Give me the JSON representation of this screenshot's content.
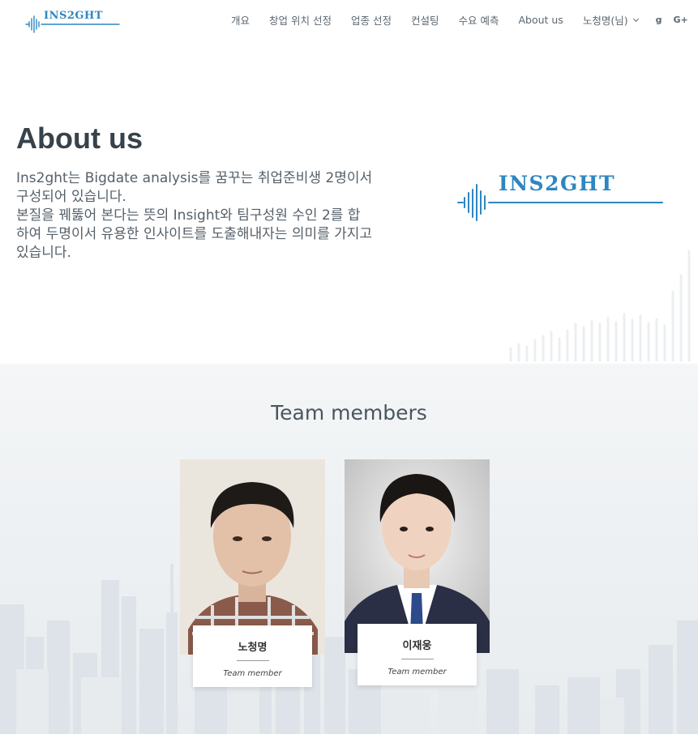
{
  "header": {
    "logo_text": "INS2GHT",
    "nav": [
      "개요",
      "창업 위치 선정",
      "업종 선정",
      "컨설팅",
      "수요 예측",
      "About us"
    ],
    "user_menu": "노청명(님)",
    "social": [
      "g",
      "G+"
    ]
  },
  "about": {
    "title": "About us",
    "paragraph_1": "Ins2ght는 Bigdate analysis를 꿈꾸는 취업준비생 2명이서 구성되어 있습니다.",
    "paragraph_2": "본질을 꿰뚫어 본다는 뜻의 Insight와 팀구성원 수인 2를 합하여 두명이서 유용한 인사이트를 도출해내자는 의미를 가지고 있습니다.",
    "logo_text": "INS2GHT"
  },
  "team": {
    "title": "Team members",
    "members": [
      {
        "name": "노청명",
        "role": "Team member"
      },
      {
        "name": "이재웅",
        "role": "Team member"
      }
    ]
  },
  "colors": {
    "brand_blue": "#2e86c1",
    "heading": "#37424a",
    "text": "#55606a"
  }
}
